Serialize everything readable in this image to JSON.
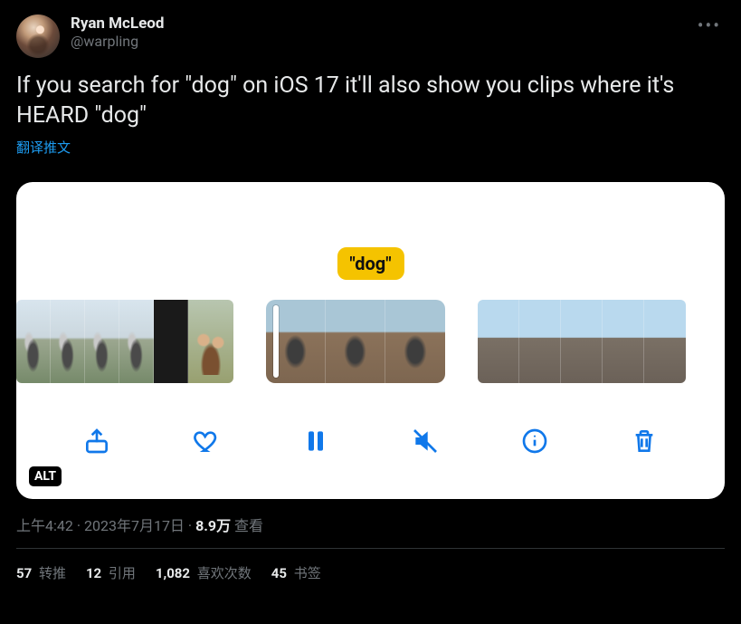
{
  "user": {
    "display_name": "Ryan McLeod",
    "handle": "@warpling"
  },
  "tweet_text": "If you search for \"dog\" on iOS 17 it'll also show you clips where it's HEARD \"dog\"",
  "translate_label": "翻译推文",
  "media": {
    "alt_badge": "ALT",
    "tooltip": "\"dog\""
  },
  "meta": {
    "time": "上午4:42",
    "date": "2023年7月17日",
    "sep": " · ",
    "views_num": "8.9万",
    "views_label": " 查看"
  },
  "stats": {
    "retweets": {
      "num": "57",
      "label": " 转推"
    },
    "quotes": {
      "num": "12",
      "label": " 引用"
    },
    "likes": {
      "num": "1,082",
      "label": " 喜欢次数"
    },
    "bookmarks": {
      "num": "45",
      "label": " 书签"
    }
  },
  "toolbar": {
    "share": "share",
    "like": "like",
    "pause": "pause",
    "mute": "mute",
    "info": "info",
    "delete": "delete"
  }
}
